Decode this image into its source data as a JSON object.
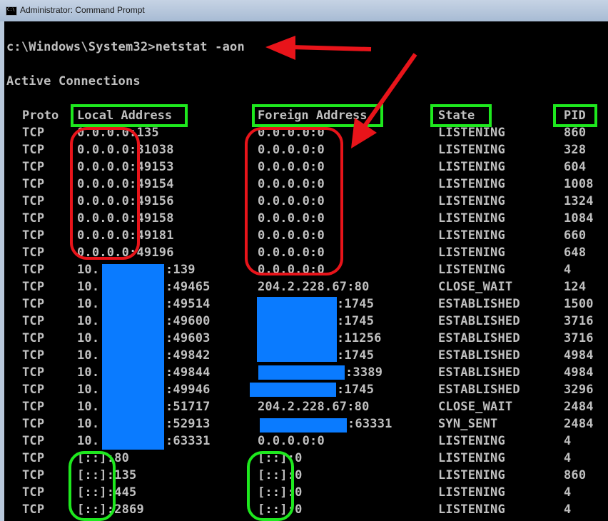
{
  "window": {
    "title": "Administrator: Command Prompt"
  },
  "console": {
    "prompt_line": "c:\\Windows\\System32>netstat -aon",
    "section_title": "Active Connections",
    "headers": {
      "proto": "Proto",
      "local": "Local Address",
      "foreign": "Foreign Address",
      "state": "State",
      "pid": "PID"
    },
    "rows": [
      {
        "proto": "TCP",
        "local": "0.0.0.0:135",
        "foreign": "0.0.0.0:0",
        "state": "LISTENING",
        "pid": "860"
      },
      {
        "proto": "TCP",
        "local": "0.0.0.0:31038",
        "foreign": "0.0.0.0:0",
        "state": "LISTENING",
        "pid": "328"
      },
      {
        "proto": "TCP",
        "local": "0.0.0.0:49153",
        "foreign": "0.0.0.0:0",
        "state": "LISTENING",
        "pid": "604"
      },
      {
        "proto": "TCP",
        "local": "0.0.0.0:49154",
        "foreign": "0.0.0.0:0",
        "state": "LISTENING",
        "pid": "1008"
      },
      {
        "proto": "TCP",
        "local": "0.0.0.0:49156",
        "foreign": "0.0.0.0:0",
        "state": "LISTENING",
        "pid": "1324"
      },
      {
        "proto": "TCP",
        "local": "0.0.0.0:49158",
        "foreign": "0.0.0.0:0",
        "state": "LISTENING",
        "pid": "1084"
      },
      {
        "proto": "TCP",
        "local": "0.0.0.0:49181",
        "foreign": "0.0.0.0:0",
        "state": "LISTENING",
        "pid": "660"
      },
      {
        "proto": "TCP",
        "local": "0.0.0.0:49196",
        "foreign": "0.0.0.0:0",
        "state": "LISTENING",
        "pid": "648"
      },
      {
        "proto": "TCP",
        "local": "10.",
        "local_port": ":139",
        "foreign": "0.0.0.0:0",
        "state": "LISTENING",
        "pid": "4"
      },
      {
        "proto": "TCP",
        "local": "10.",
        "local_port": ":49465",
        "foreign": "204.2.228.67:80",
        "state": "CLOSE_WAIT",
        "pid": "124"
      },
      {
        "proto": "TCP",
        "local": "10.",
        "local_port": ":49514",
        "foreign": "",
        "foreign_port": ":1745",
        "state": "ESTABLISHED",
        "pid": "1500"
      },
      {
        "proto": "TCP",
        "local": "10.",
        "local_port": ":49600",
        "foreign": "",
        "foreign_port": ":1745",
        "state": "ESTABLISHED",
        "pid": "3716"
      },
      {
        "proto": "TCP",
        "local": "10.",
        "local_port": ":49603",
        "foreign": "",
        "foreign_port": ":11256",
        "state": "ESTABLISHED",
        "pid": "3716"
      },
      {
        "proto": "TCP",
        "local": "10.",
        "local_port": ":49842",
        "foreign": "",
        "foreign_port": ":1745",
        "state": "ESTABLISHED",
        "pid": "4984"
      },
      {
        "proto": "TCP",
        "local": "10.",
        "local_port": ":49844",
        "foreign": "",
        "foreign_port": ":3389",
        "state": "ESTABLISHED",
        "pid": "4984"
      },
      {
        "proto": "TCP",
        "local": "10.",
        "local_port": ":49946",
        "foreign": "",
        "foreign_port": ":1745",
        "state": "ESTABLISHED",
        "pid": "3296"
      },
      {
        "proto": "TCP",
        "local": "10.",
        "local_port": ":51717",
        "foreign": "204.2.228.67:80",
        "state": "CLOSE_WAIT",
        "pid": "2484"
      },
      {
        "proto": "TCP",
        "local": "10.",
        "local_port": ":52913",
        "foreign": "",
        "foreign_port": ":63331",
        "state": "SYN_SENT",
        "pid": "2484"
      },
      {
        "proto": "TCP",
        "local": "10.",
        "local_port": ":63331",
        "foreign": "0.0.0.0:0",
        "state": "LISTENING",
        "pid": "4"
      },
      {
        "proto": "TCP",
        "local": "[::]:80",
        "foreign": "[::]:0",
        "state": "LISTENING",
        "pid": "4"
      },
      {
        "proto": "TCP",
        "local": "[::]:135",
        "foreign": "[::]:0",
        "state": "LISTENING",
        "pid": "860"
      },
      {
        "proto": "TCP",
        "local": "[::]:445",
        "foreign": "[::]:0",
        "state": "LISTENING",
        "pid": "4"
      },
      {
        "proto": "TCP",
        "local": "[::]:2869",
        "foreign": "[::]:0",
        "state": "LISTENING",
        "pid": "4"
      }
    ]
  },
  "colors": {
    "console_bg": "#000000",
    "console_text": "#c0c0c0",
    "redaction": "#0a7bff",
    "highlight_green": "#1ee81e",
    "highlight_red": "#e8141a"
  }
}
